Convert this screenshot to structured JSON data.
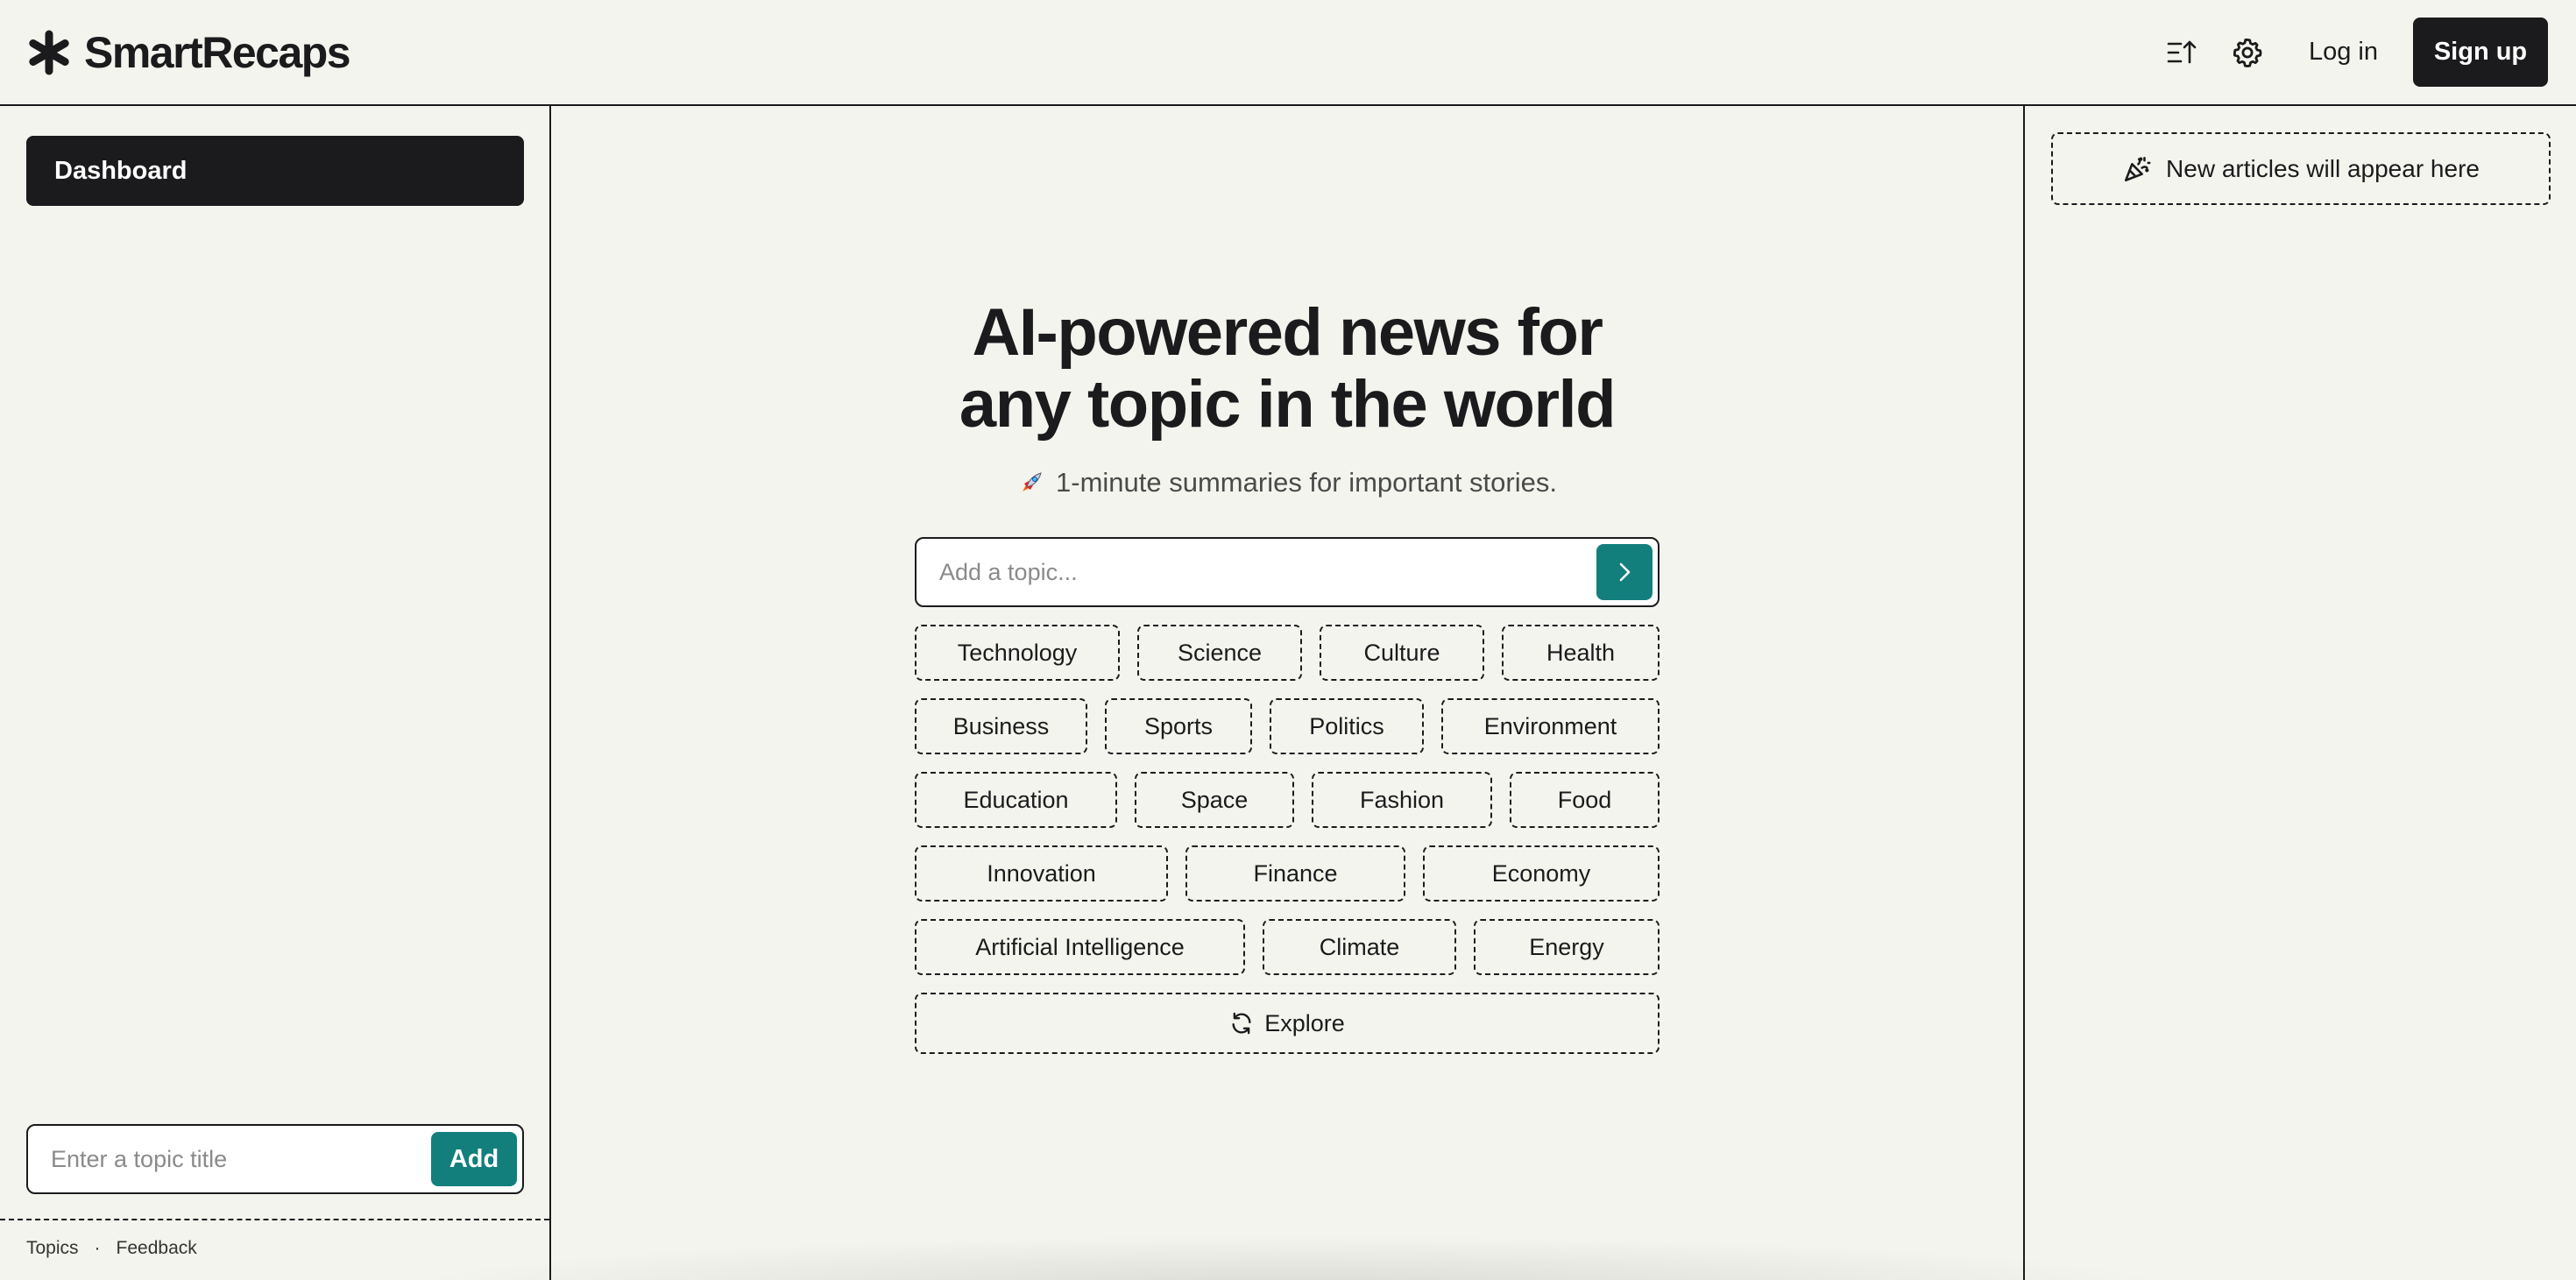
{
  "header": {
    "brand": "SmartRecaps",
    "login_label": "Log in",
    "signup_label": "Sign up"
  },
  "sidebar": {
    "dashboard_label": "Dashboard",
    "topic_placeholder": "Enter a topic title",
    "add_label": "Add",
    "footer": {
      "topics_label": "Topics",
      "separator": "·",
      "feedback_label": "Feedback"
    }
  },
  "main": {
    "title_line1": "AI-powered news for",
    "title_line2": "any topic in the world",
    "subtitle": "1-minute summaries for important stories.",
    "search_placeholder": "Add a topic...",
    "explore_label": "Explore",
    "chip_rows": [
      [
        "Technology",
        "Science",
        "Culture",
        "Health"
      ],
      [
        "Business",
        "Sports",
        "Politics",
        "Environment"
      ],
      [
        "Education",
        "Space",
        "Fashion",
        "Food"
      ],
      [
        "Innovation",
        "Finance",
        "Economy"
      ],
      [
        "Artificial Intelligence",
        "Climate",
        "Energy"
      ]
    ]
  },
  "right_panel": {
    "new_articles_label": "New articles will appear here"
  },
  "colors": {
    "background": "#f4f4ef",
    "dark": "#1b1b1d",
    "accent": "#137f7d"
  },
  "icons": {
    "brand": "asterisk-icon",
    "sort": "sort-ascending-icon",
    "settings": "gear-icon",
    "go": "chevron-right-icon",
    "explore": "refresh-icon",
    "new_articles": "party-popper-icon",
    "subtitle": "rocket-icon"
  }
}
